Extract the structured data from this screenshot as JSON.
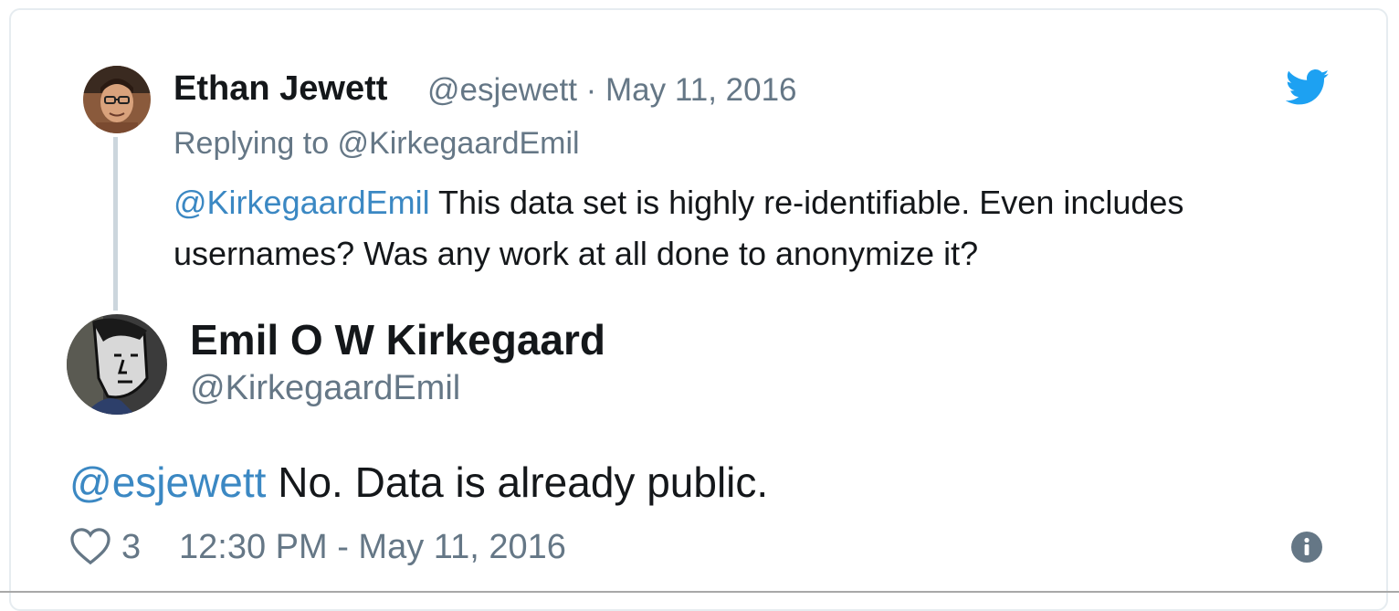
{
  "quoted_tweet": {
    "author_name": "Ethan Jewett",
    "author_meta": "@esjewett · May 11, 2016",
    "replying_to": "Replying to @KirkegaardEmil",
    "mention": "@KirkegaardEmil",
    "text": " This data set is highly re-identifiable. Even includes usernames? Was any work at all done to anonymize it?"
  },
  "main_tweet": {
    "author_name": "Emil O W Kirkegaard",
    "author_handle": "@KirkegaardEmil",
    "mention": "@esjewett",
    "text": " No. Data is already public.",
    "likes": "3",
    "timestamp": "12:30 PM - May 11, 2016"
  },
  "icons": {
    "brand": "twitter-bird-icon",
    "like": "heart-icon",
    "info": "info-icon"
  },
  "colors": {
    "brand": "#1da1f2",
    "link": "#3b88c3",
    "muted": "#657786",
    "text": "#14171a"
  }
}
